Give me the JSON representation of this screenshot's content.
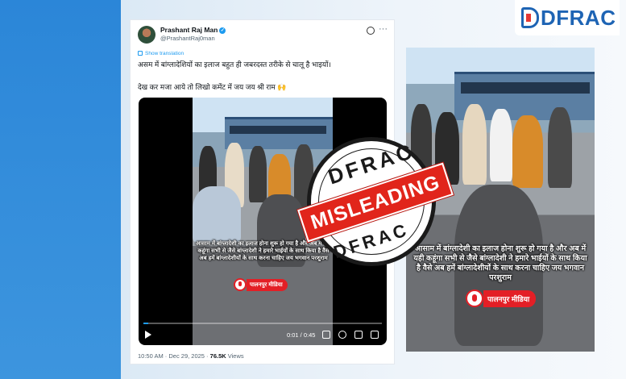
{
  "logo": {
    "text": "DFRAC"
  },
  "tweet": {
    "author_name": "Prashant Raj Man",
    "author_handle": "@PrashantRaj0man",
    "show_translation": "Show translation",
    "text_line1": "असम में बांग्लादेशियों का इलाज बहुत ही जबरदस्त तरीके से चालू है भाइयों।",
    "text_line2": "देख कर मजा आये तो लिखो कमेंट में जय जय श्री राम 🙌",
    "timestamp": "10:50 AM · Dec 29, 2025 ·",
    "views_count": "76.5K",
    "views_label": "Views"
  },
  "video": {
    "overlay_text": "आसाम में बांग्लादेशी का इलाज होना शुरू हो गया है और अब में यही कहूंगा सभी से जैसे बांग्लादेशी ने हमारे भाईयों के साथ किया है वैसे अब हमें बांग्लादेशीयों के साथ करना चाहिए जय भगवान परशुराम",
    "media_badge": "पालनपुर मीडिया",
    "time": "0:01 / 0:45",
    "progress": 0.02
  },
  "right_image": {
    "overlay_text": "आसाम में बांग्लादेशी का इलाज होना शुरू हो गया है और अब में यही कहूंगा सभी से जैसे बांग्लादेशी ने हमारे भाईयों के साथ किया है वैसे अब हमें बांग्लादेशीयों के साथ करना चाहिए जय भगवान परशुराम",
    "media_badge": "पालनपुर मीडिया"
  },
  "stamp": {
    "top": "DFRAC",
    "label": "MISLEADING",
    "bottom": "DFRAC",
    "color": "#e1251b"
  },
  "colors": {
    "accent": "#1d9bf0",
    "brand": "#1e64b4"
  }
}
